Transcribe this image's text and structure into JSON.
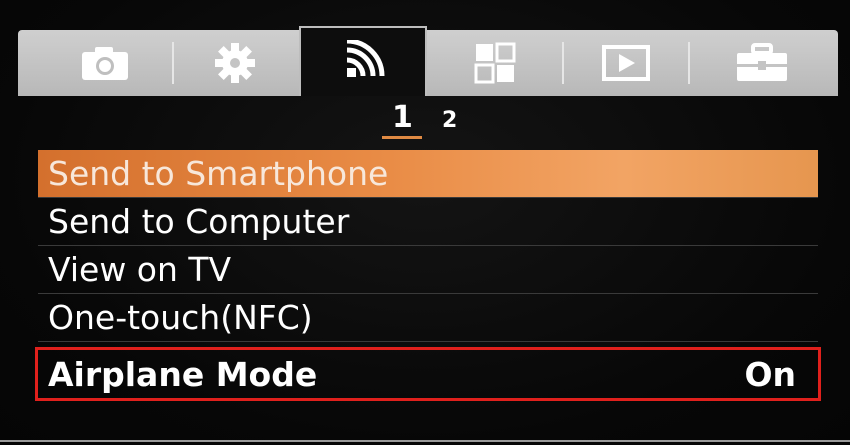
{
  "tabs": [
    {
      "icon": "camera-icon",
      "active": false
    },
    {
      "icon": "gear-icon",
      "active": false
    },
    {
      "icon": "wireless-icon",
      "active": true
    },
    {
      "icon": "applications-icon",
      "active": false
    },
    {
      "icon": "playback-icon",
      "active": false
    },
    {
      "icon": "toolbox-icon",
      "active": false
    }
  ],
  "pages": {
    "current": "1",
    "other": "2"
  },
  "menu": {
    "items": [
      {
        "label": "Send to Smartphone",
        "value": ""
      },
      {
        "label": "Send to Computer",
        "value": ""
      },
      {
        "label": "View on TV",
        "value": ""
      },
      {
        "label": "One-touch(NFC)",
        "value": ""
      },
      {
        "label": "Airplane Mode",
        "value": "On"
      }
    ]
  },
  "colors": {
    "selection": "#e98c46",
    "highlight_box": "#e0201c",
    "tabbar": "#c4c4c4"
  }
}
